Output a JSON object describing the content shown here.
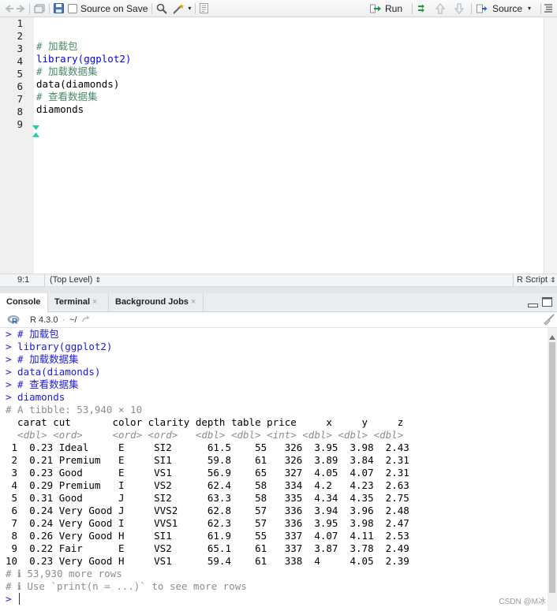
{
  "editor_toolbar": {
    "source_on_save_label": "Source on Save",
    "run_label": "Run",
    "source_label": "Source"
  },
  "editor": {
    "line_numbers": [
      "1",
      "2",
      "3",
      "4",
      "5",
      "6",
      "7",
      "8",
      "9"
    ],
    "lines": [
      "",
      "",
      "# 加载包",
      "library(ggplot2)",
      "# 加载数据集",
      "data(diamonds)",
      "# 查看数据集",
      "diamonds",
      ""
    ]
  },
  "statusbar": {
    "cursor_position": "9:1",
    "scope": "(Top Level)",
    "file_type": "R Script"
  },
  "console_tabs": [
    {
      "label": "Console",
      "active": true
    },
    {
      "label": "Terminal",
      "active": false
    },
    {
      "label": "Background Jobs",
      "active": false
    }
  ],
  "console_header": {
    "r_version": "R 4.3.0",
    "working_dir": "~/"
  },
  "console": {
    "commands": [
      "> # 加载包",
      "> library(ggplot2)",
      "> # 加载数据集",
      "> data(diamonds)",
      "> # 查看数据集",
      "> diamonds"
    ],
    "tibble_header": "# A tibble: 53,940 × 10",
    "column_header": "  carat cut       color clarity depth table price     x     y     z",
    "column_types": "  <dbl> <ord>     <ord> <ord>   <dbl> <dbl> <int> <dbl> <dbl> <dbl>",
    "rows": [
      " 1  0.23 Ideal     E     SI2      61.5    55   326  3.95  3.98  2.43",
      " 2  0.21 Premium   E     SI1      59.8    61   326  3.89  3.84  2.31",
      " 3  0.23 Good      E     VS1      56.9    65   327  4.05  4.07  2.31",
      " 4  0.29 Premium   I     VS2      62.4    58   334  4.2   4.23  2.63",
      " 5  0.31 Good      J     SI2      63.3    58   335  4.34  4.35  2.75",
      " 6  0.24 Very Good J     VVS2     62.8    57   336  3.94  3.96  2.48",
      " 7  0.24 Very Good I     VVS1     62.3    57   336  3.95  3.98  2.47",
      " 8  0.26 Very Good H     SI1      61.9    55   337  4.07  4.11  2.53",
      " 9  0.22 Fair      E     VS2      65.1    61   337  3.87  3.78  2.49",
      "10  0.23 Very Good H     VS1      59.4    61   338  4     4.05  2.39"
    ],
    "more_rows": "# ℹ 53,930 more rows",
    "hint": "# ℹ Use `print(n = ...)` to see more rows",
    "final_prompt": ">"
  },
  "watermark": "CSDN @M冰",
  "colors": {
    "comment": "#4c886b",
    "code": "#0000ff",
    "prompt": "#1c1cd6",
    "output_meta": "#8d8d8d"
  }
}
